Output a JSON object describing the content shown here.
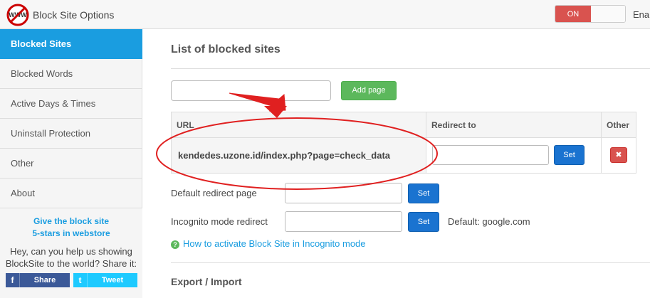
{
  "header": {
    "title": "Block Site Options",
    "logo_text": "WWW",
    "toggle_on": "ON",
    "enable_label": "Ena"
  },
  "sidebar": {
    "items": [
      {
        "label": "Blocked Sites",
        "active": true
      },
      {
        "label": "Blocked Words"
      },
      {
        "label": "Active Days & Times"
      },
      {
        "label": "Uninstall Protection"
      },
      {
        "label": "Other"
      },
      {
        "label": "About"
      }
    ],
    "rate_line1": "Give the block site",
    "rate_line2": "5-stars in webstore",
    "share_line1": "Hey, can you help us showing",
    "share_line2": "BlockSite to the world? Share it:",
    "share_button": "Share",
    "tweet_button": "Tweet"
  },
  "main": {
    "title": "List of blocked sites",
    "add_button": "Add page",
    "table": {
      "col_url": "URL",
      "col_redirect": "Redirect to",
      "col_other": "Other",
      "rows": [
        {
          "url": "kendedes.uzone.id/index.php?page=check_data",
          "set_label": "Set"
        }
      ]
    },
    "default_redirect_label": "Default redirect page",
    "default_set": "Set",
    "incognito_label": "Incognito mode redirect",
    "incognito_set": "Set",
    "incognito_default": "Default: google.com",
    "help_link": "How to activate Block Site in Incognito mode",
    "export_title": "Export / Import"
  },
  "colors": {
    "accent": "#1a9de0",
    "toggle_on": "#d9534f",
    "add_button": "#5cb85c",
    "set_button": "#1a73d0",
    "annotation": "#e02020"
  }
}
